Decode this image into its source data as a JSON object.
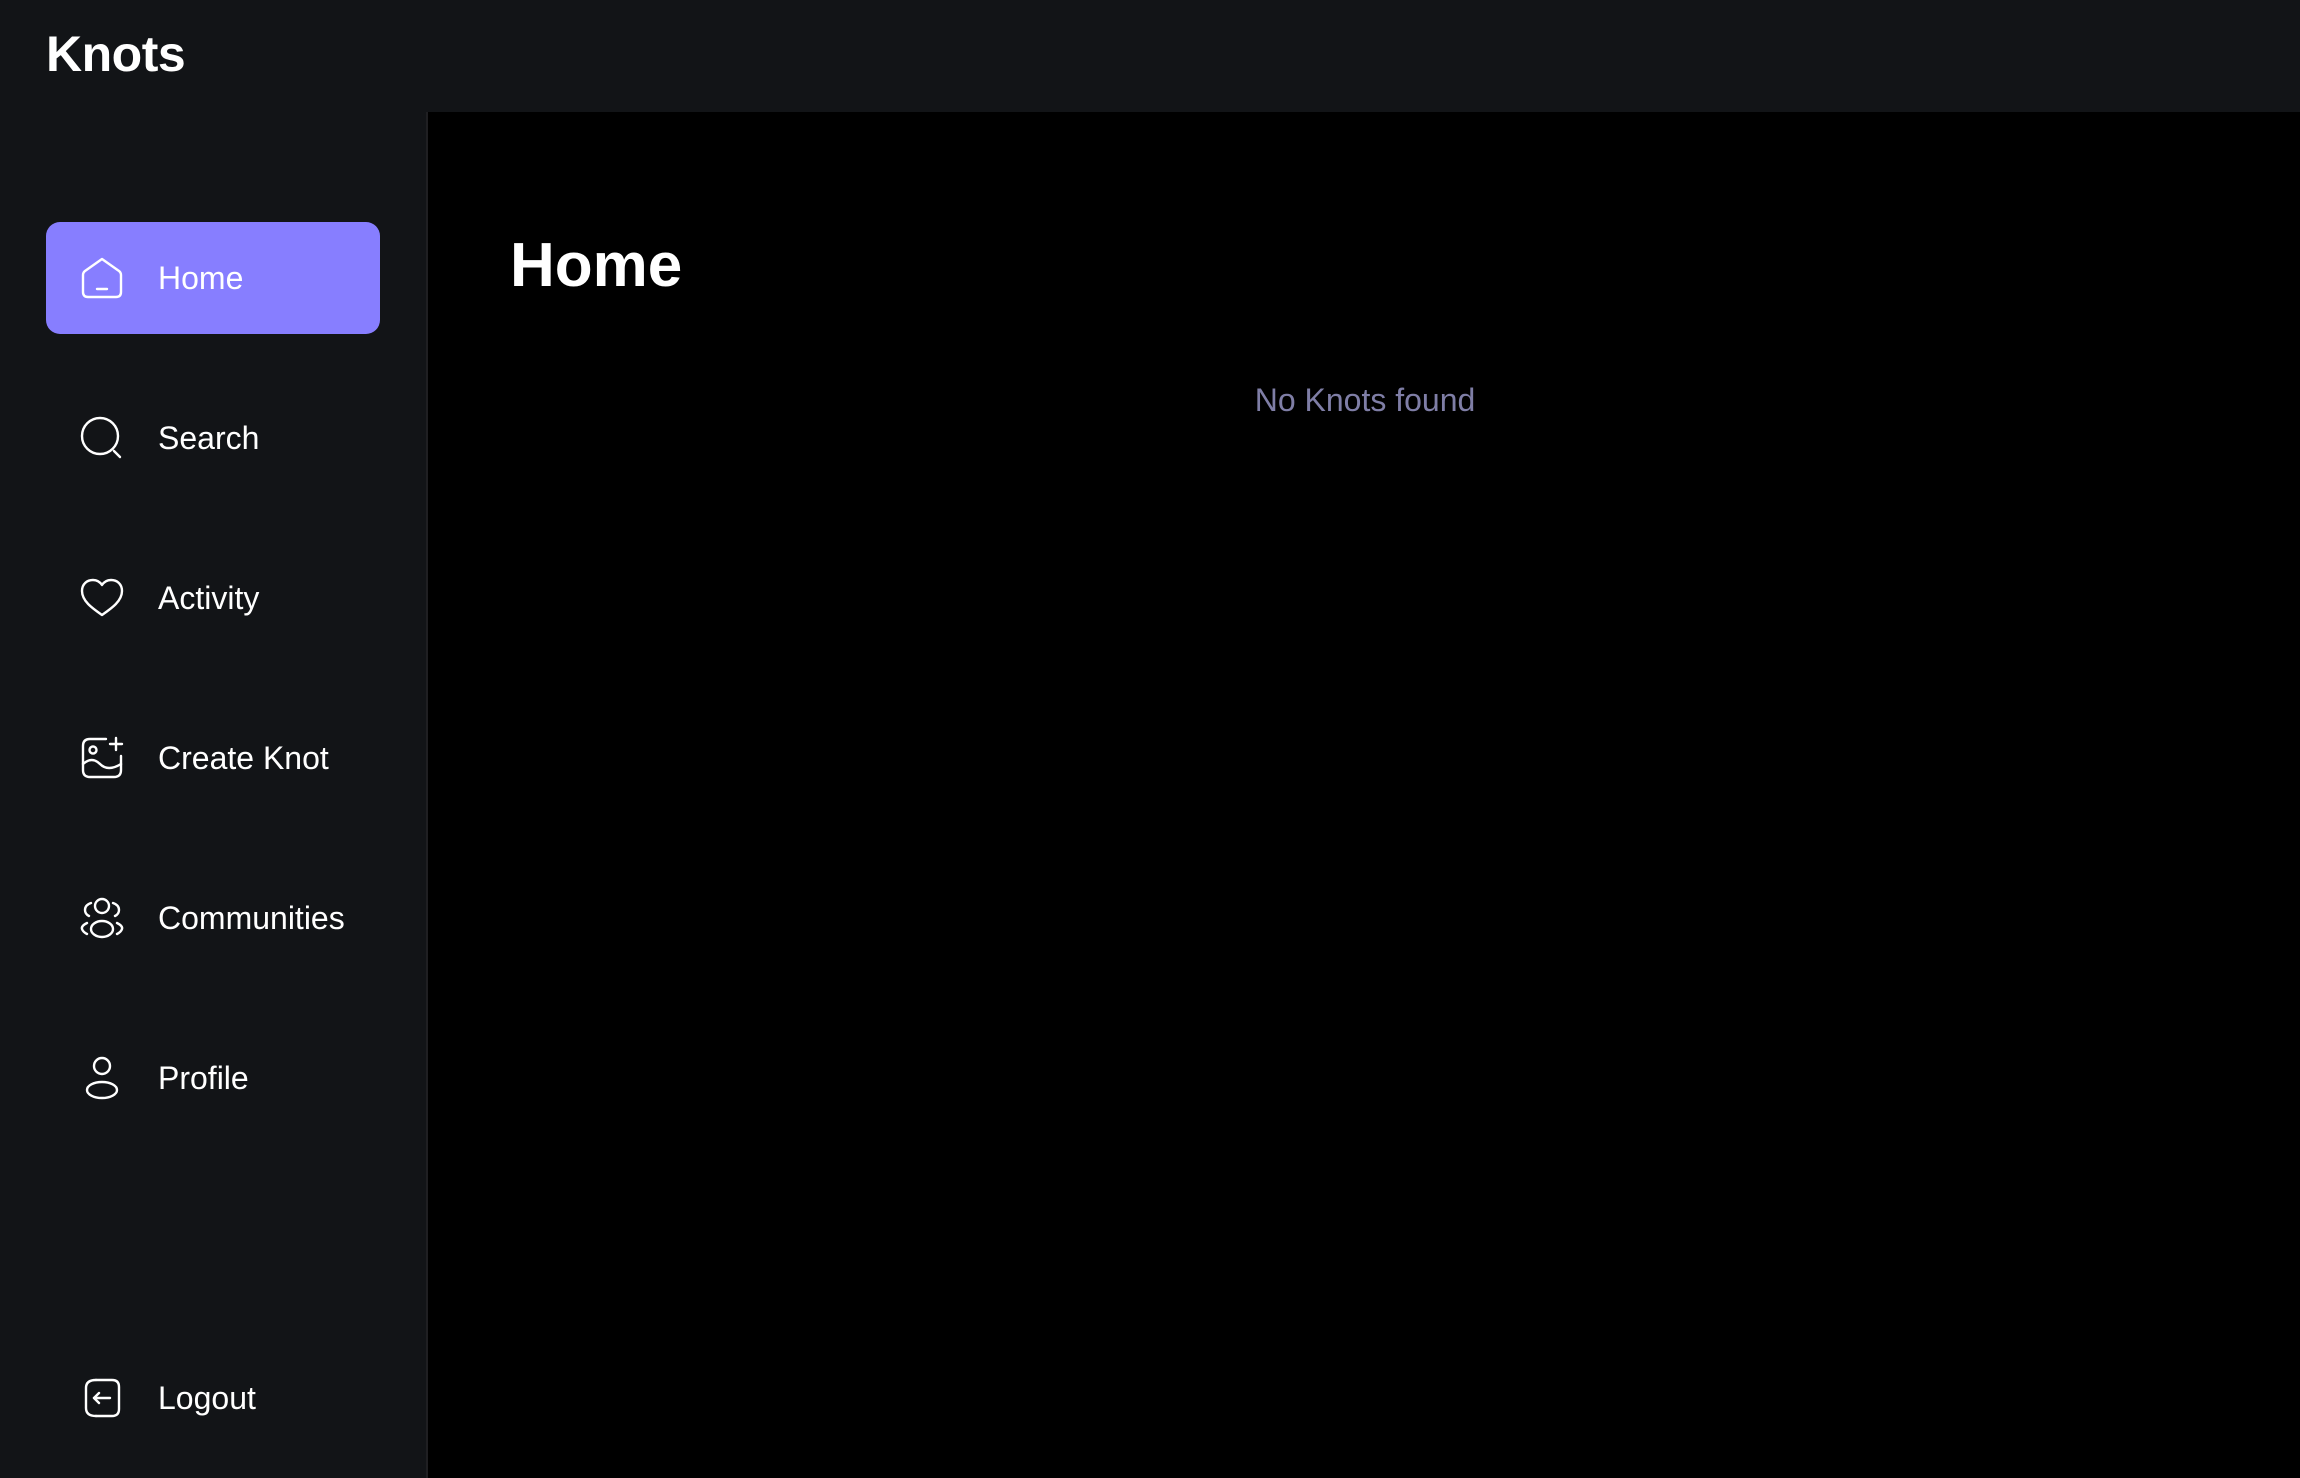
{
  "app": {
    "brand": "Knots"
  },
  "sidebar": {
    "items": [
      {
        "label": "Home",
        "icon": "home-icon",
        "active": true
      },
      {
        "label": "Search",
        "icon": "search-icon",
        "active": false
      },
      {
        "label": "Activity",
        "icon": "heart-icon",
        "active": false
      },
      {
        "label": "Create Knot",
        "icon": "image-plus-icon",
        "active": false
      },
      {
        "label": "Communities",
        "icon": "users-icon",
        "active": false
      },
      {
        "label": "Profile",
        "icon": "user-icon",
        "active": false
      }
    ],
    "logout": {
      "label": "Logout",
      "icon": "logout-icon"
    }
  },
  "main": {
    "title": "Home",
    "empty_message": "No Knots found"
  },
  "colors": {
    "accent": "#877EFF",
    "panel": "#121417",
    "background": "#000000",
    "muted_text": "#7f7ea6"
  }
}
